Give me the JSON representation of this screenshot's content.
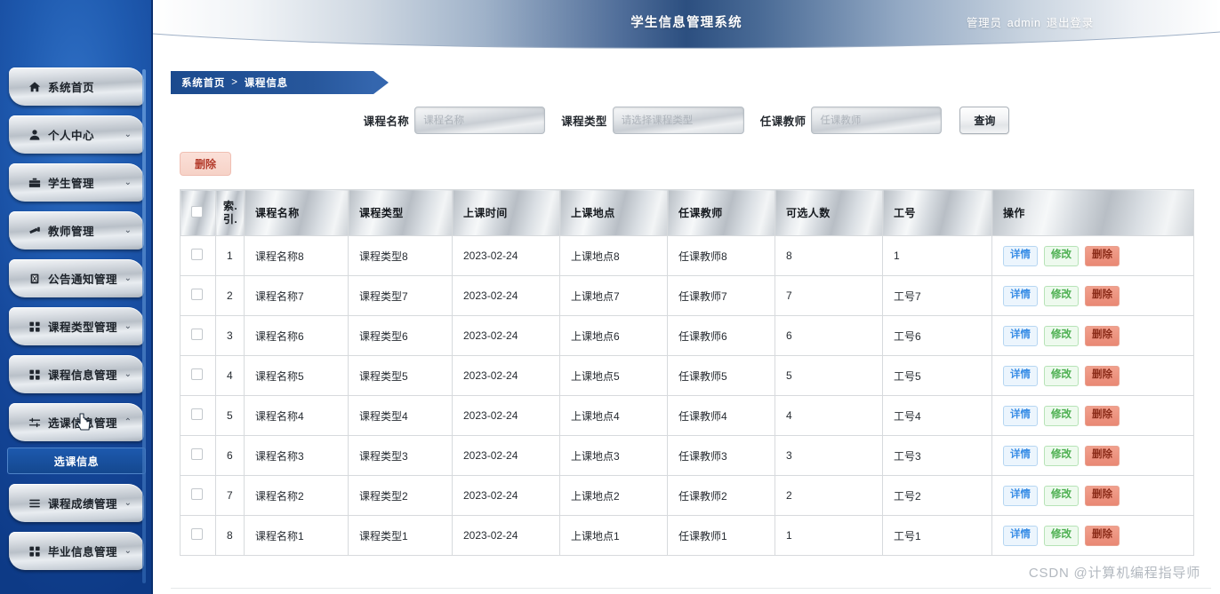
{
  "header": {
    "app_title": "学生信息管理系统",
    "user_role": "管理员",
    "user_name": "admin",
    "logout_label": "退出登录"
  },
  "breadcrumb": {
    "home": "系统首页",
    "separator": ">",
    "current": "课程信息"
  },
  "sidebar": {
    "items": [
      {
        "label": "系统首页",
        "icon": "home-icon",
        "has_arrow": false,
        "expanded": false
      },
      {
        "label": "个人中心",
        "icon": "user-icon",
        "has_arrow": true,
        "expanded": false
      },
      {
        "label": "学生管理",
        "icon": "briefcase-icon",
        "has_arrow": true,
        "expanded": false
      },
      {
        "label": "教师管理",
        "icon": "teacher-icon",
        "has_arrow": true,
        "expanded": false
      },
      {
        "label": "公告通知管理",
        "icon": "clipboard-icon",
        "has_arrow": true,
        "expanded": false
      },
      {
        "label": "课程类型管理",
        "icon": "grid-icon",
        "has_arrow": true,
        "expanded": false
      },
      {
        "label": "课程信息管理",
        "icon": "grid-icon",
        "has_arrow": true,
        "expanded": false
      },
      {
        "label": "选课信息管理",
        "icon": "sliders-icon",
        "has_arrow": true,
        "expanded": true
      },
      {
        "label": "课程成绩管理",
        "icon": "list-icon",
        "has_arrow": true,
        "expanded": false
      },
      {
        "label": "毕业信息管理",
        "icon": "grid-icon",
        "has_arrow": true,
        "expanded": false
      }
    ],
    "submenu": {
      "parent_index": 7,
      "label": "选课信息",
      "active": true
    },
    "arrow_down": "⌄",
    "arrow_up": "⌃"
  },
  "search": {
    "fields": [
      {
        "label": "课程名称",
        "placeholder": "课程名称",
        "value": "",
        "type": "text"
      },
      {
        "label": "课程类型",
        "placeholder": "请选择课程类型",
        "value": "",
        "type": "select"
      },
      {
        "label": "任课教师",
        "placeholder": "任课教师",
        "value": "",
        "type": "text"
      }
    ],
    "query_label": "查询"
  },
  "toolbar": {
    "delete_label": "删除"
  },
  "table": {
    "columns": [
      "",
      "索.引.",
      "课程名称",
      "课程类型",
      "上课时间",
      "上课地点",
      "任课教师",
      "可选人数",
      "工号",
      "操作"
    ],
    "column_index_line1": "索.",
    "column_index_line2": "引.",
    "actions": {
      "detail": "详情",
      "edit": "修改",
      "delete": "删除"
    },
    "rows": [
      {
        "index": "1",
        "course_name": "课程名称8",
        "course_type": "课程类型8",
        "class_time": "2023-02-24",
        "class_place": "上课地点8",
        "teacher": "任课教师8",
        "capacity": "8",
        "job_no": "1"
      },
      {
        "index": "2",
        "course_name": "课程名称7",
        "course_type": "课程类型7",
        "class_time": "2023-02-24",
        "class_place": "上课地点7",
        "teacher": "任课教师7",
        "capacity": "7",
        "job_no": "工号7"
      },
      {
        "index": "3",
        "course_name": "课程名称6",
        "course_type": "课程类型6",
        "class_time": "2023-02-24",
        "class_place": "上课地点6",
        "teacher": "任课教师6",
        "capacity": "6",
        "job_no": "工号6"
      },
      {
        "index": "4",
        "course_name": "课程名称5",
        "course_type": "课程类型5",
        "class_time": "2023-02-24",
        "class_place": "上课地点5",
        "teacher": "任课教师5",
        "capacity": "5",
        "job_no": "工号5"
      },
      {
        "index": "5",
        "course_name": "课程名称4",
        "course_type": "课程类型4",
        "class_time": "2023-02-24",
        "class_place": "上课地点4",
        "teacher": "任课教师4",
        "capacity": "4",
        "job_no": "工号4"
      },
      {
        "index": "6",
        "course_name": "课程名称3",
        "course_type": "课程类型3",
        "class_time": "2023-02-24",
        "class_place": "上课地点3",
        "teacher": "任课教师3",
        "capacity": "3",
        "job_no": "工号3"
      },
      {
        "index": "7",
        "course_name": "课程名称2",
        "course_type": "课程类型2",
        "class_time": "2023-02-24",
        "class_place": "上课地点2",
        "teacher": "任课教师2",
        "capacity": "2",
        "job_no": "工号2"
      },
      {
        "index": "8",
        "course_name": "课程名称1",
        "course_type": "课程类型1",
        "class_time": "2023-02-24",
        "class_place": "上课地点1",
        "teacher": "任课教师1",
        "capacity": "1",
        "job_no": "工号1"
      }
    ]
  },
  "watermark": "CSDN @计算机编程指导师",
  "colors": {
    "sidebar_blue": "#15479a",
    "header_dark": "#2c4f80",
    "breadcrumb_blue": "#27579c",
    "detail_blue": "#3a8ee6",
    "edit_green": "#4caf50",
    "delete_red": "#b33a2a"
  }
}
